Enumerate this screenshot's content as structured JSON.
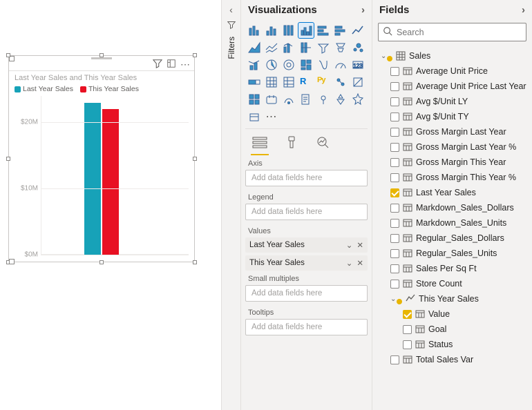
{
  "canvas": {
    "title": "Last Year Sales and This Year Sales",
    "legend": [
      {
        "label": "Last Year Sales",
        "color": "#17a2b8"
      },
      {
        "label": "This Year Sales",
        "color": "#e81123"
      }
    ]
  },
  "chart_data": {
    "type": "bar",
    "categories": [
      ""
    ],
    "series": [
      {
        "name": "Last Year Sales",
        "values": [
          23000000
        ],
        "color": "#17a2b8"
      },
      {
        "name": "This Year Sales",
        "values": [
          22000000
        ],
        "color": "#e81123"
      }
    ],
    "ylabel": "",
    "ylim": [
      0,
      24000000
    ],
    "yticks": [
      {
        "v": 0,
        "label": "$0M"
      },
      {
        "v": 10000000,
        "label": "$10M"
      },
      {
        "v": 20000000,
        "label": "$20M"
      }
    ]
  },
  "filters": {
    "label": "Filters"
  },
  "viz": {
    "title": "Visualizations",
    "mode_fields_selected": true,
    "wells": {
      "axis": {
        "label": "Axis",
        "placeholder": "Add data fields here"
      },
      "legend": {
        "label": "Legend",
        "placeholder": "Add data fields here"
      },
      "values": {
        "label": "Values",
        "chips": [
          "Last Year Sales",
          "This Year Sales"
        ]
      },
      "small": {
        "label": "Small multiples",
        "placeholder": "Add data fields here"
      },
      "tooltips": {
        "label": "Tooltips",
        "placeholder": "Add data fields here"
      }
    }
  },
  "fields": {
    "title": "Fields",
    "search_placeholder": "Search",
    "tables": [
      {
        "name": "Sales",
        "expanded": true,
        "highlighted": true,
        "fields": [
          {
            "name": "Average Unit Price",
            "checked": false
          },
          {
            "name": "Average Unit Price Last Year",
            "checked": false
          },
          {
            "name": "Avg $/Unit LY",
            "checked": false
          },
          {
            "name": "Avg $/Unit TY",
            "checked": false
          },
          {
            "name": "Gross Margin Last Year",
            "checked": false
          },
          {
            "name": "Gross Margin Last Year %",
            "checked": false
          },
          {
            "name": "Gross Margin This Year",
            "checked": false
          },
          {
            "name": "Gross Margin This Year %",
            "checked": false
          },
          {
            "name": "Last Year Sales",
            "checked": true
          },
          {
            "name": "Markdown_Sales_Dollars",
            "checked": false
          },
          {
            "name": "Markdown_Sales_Units",
            "checked": false
          },
          {
            "name": "Regular_Sales_Dollars",
            "checked": false
          },
          {
            "name": "Regular_Sales_Units",
            "checked": false
          },
          {
            "name": "Sales Per Sq Ft",
            "checked": false
          },
          {
            "name": "Store Count",
            "checked": false
          }
        ]
      },
      {
        "name": "This Year Sales",
        "expanded": true,
        "kpi": true,
        "highlighted": true,
        "fields": [
          {
            "name": "Value",
            "checked": true
          },
          {
            "name": "Goal",
            "checked": false
          },
          {
            "name": "Status",
            "checked": false
          }
        ]
      },
      {
        "name_field_after": "Total Sales Var",
        "is_trailing_field": true
      }
    ]
  }
}
